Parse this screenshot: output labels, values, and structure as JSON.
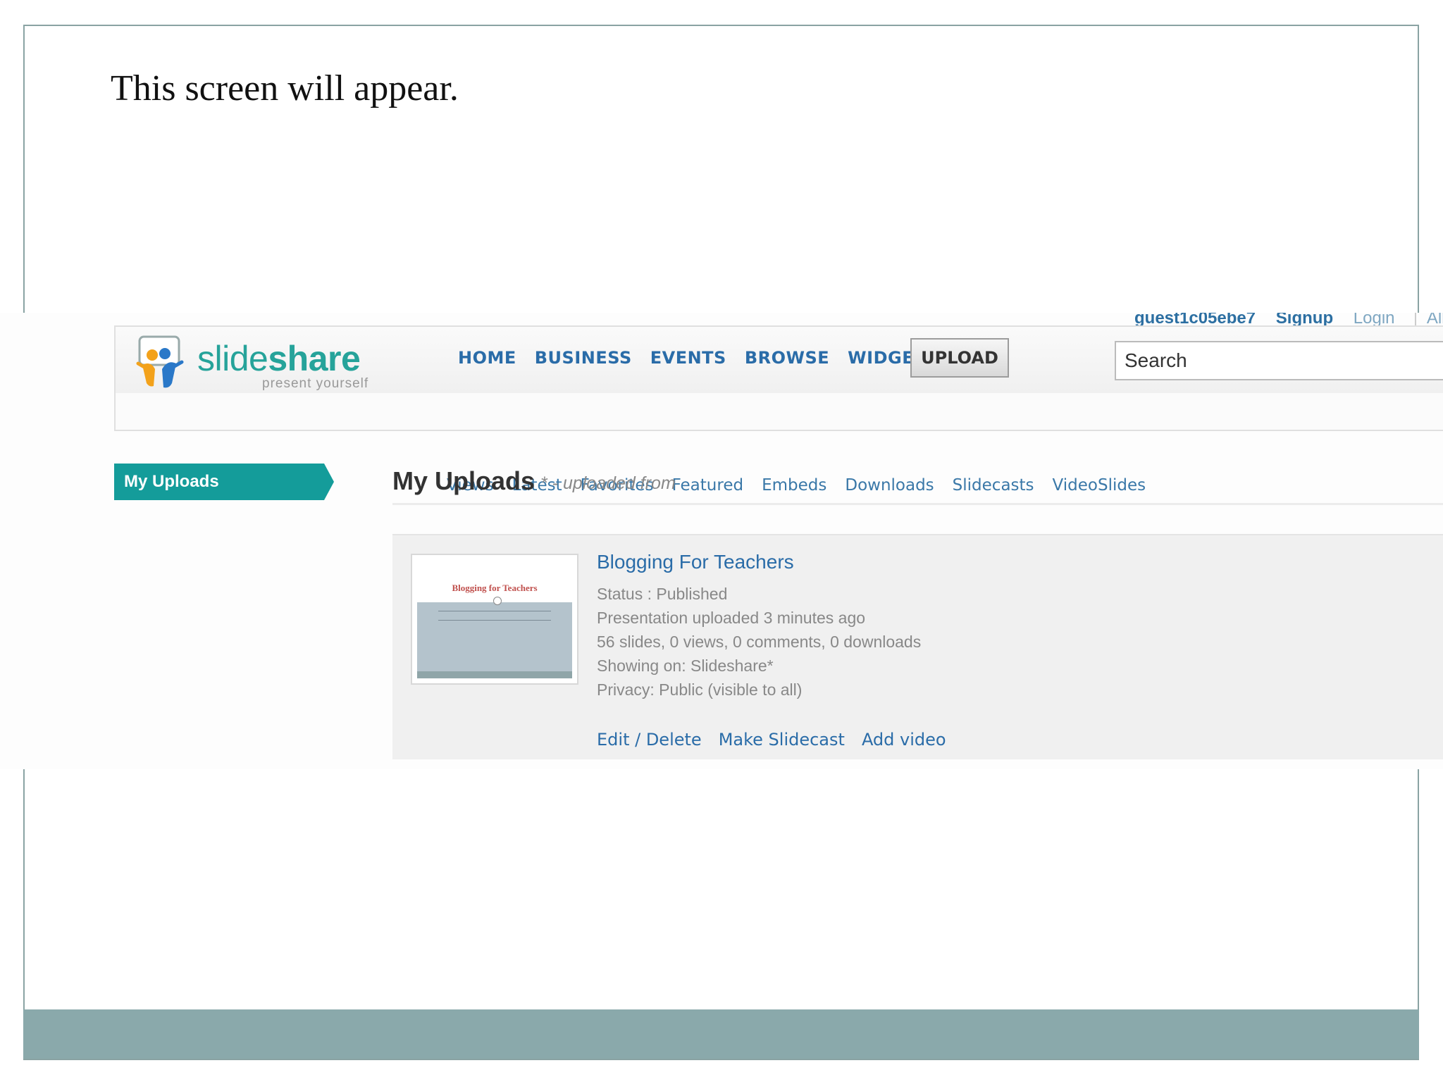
{
  "slide": {
    "caption": "This screen will appear."
  },
  "screenshot": {
    "topline": {
      "user": "guest1c05ebe7",
      "signup": "Signup",
      "login": "Login",
      "extra": "All"
    },
    "logo": {
      "word_light": "slide",
      "word_bold": "share",
      "tagline": "present yourself"
    },
    "main_nav": [
      "HOME",
      "BUSINESS",
      "EVENTS",
      "BROWSE",
      "WIDGETS"
    ],
    "upload_button": "UPLOAD",
    "search": {
      "value": "Search"
    },
    "sub_nav": [
      "Views",
      "Latest",
      "Favorites",
      "Featured",
      "Embeds",
      "Downloads",
      "Slidecasts",
      "VideoSlides"
    ],
    "sidebar": {
      "active_tab": "My Uploads"
    },
    "page": {
      "title": "My Uploads",
      "note": "* - uploaded from"
    },
    "upload_item": {
      "thumbnail_title": "Blogging for Teachers",
      "title": "Blogging For Teachers",
      "status": "Status : Published",
      "uploaded": "Presentation uploaded 3 minutes ago",
      "stats": "56 slides, 0 views, 0 comments, 0 downloads",
      "showing_on": "Showing on: Slideshare*",
      "privacy": "Privacy: Public (visible to all)",
      "actions": [
        "Edit / Delete",
        "Make Slidecast",
        "Add video"
      ]
    },
    "colors": {
      "brand_teal": "#26a39a",
      "link_blue": "#2a6ca8",
      "sidebar_active": "#149c9a",
      "footer_band": "#8aa9ab"
    }
  }
}
